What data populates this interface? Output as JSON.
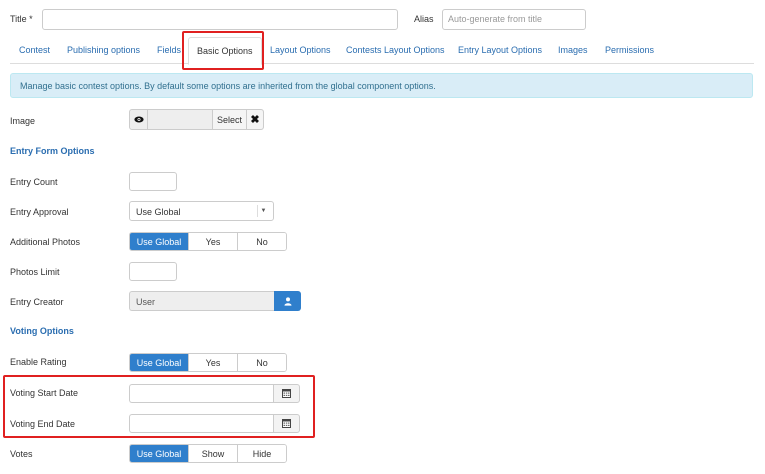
{
  "header": {
    "title_label": "Title *",
    "title_value": "",
    "alias_label": "Alias",
    "alias_placeholder": "Auto-generate from title"
  },
  "tabs": [
    {
      "label": "Contest"
    },
    {
      "label": "Publishing options"
    },
    {
      "label": "Fields"
    },
    {
      "label": "Basic Options",
      "active": true
    },
    {
      "label": "Layout Options"
    },
    {
      "label": "Contests Layout Options"
    },
    {
      "label": "Entry Layout Options"
    },
    {
      "label": "Images"
    },
    {
      "label": "Permissions"
    }
  ],
  "info_text": "Manage basic contest options. By default some options are inherited from the global component options.",
  "image": {
    "label": "Image",
    "select_label": "Select",
    "clear_label": "✖"
  },
  "entry_form": {
    "heading": "Entry Form Options",
    "entry_count_label": "Entry Count",
    "entry_approval_label": "Entry Approval",
    "entry_approval_value": "Use Global",
    "additional_photos_label": "Additional Photos",
    "additional_photos_options": [
      "Use Global",
      "Yes",
      "No"
    ],
    "photos_limit_label": "Photos Limit",
    "entry_creator_label": "Entry Creator",
    "entry_creator_value": "User"
  },
  "voting": {
    "heading": "Voting Options",
    "enable_rating_label": "Enable Rating",
    "enable_rating_options": [
      "Use Global",
      "Yes",
      "No"
    ],
    "start_date_label": "Voting Start Date",
    "end_date_label": "Voting End Date",
    "votes_label": "Votes",
    "votes_options": [
      "Use Global",
      "Show",
      "Hide"
    ]
  },
  "colors": {
    "accent": "#2f7fcc",
    "highlight": "#e02020",
    "link": "#2a6db0"
  }
}
